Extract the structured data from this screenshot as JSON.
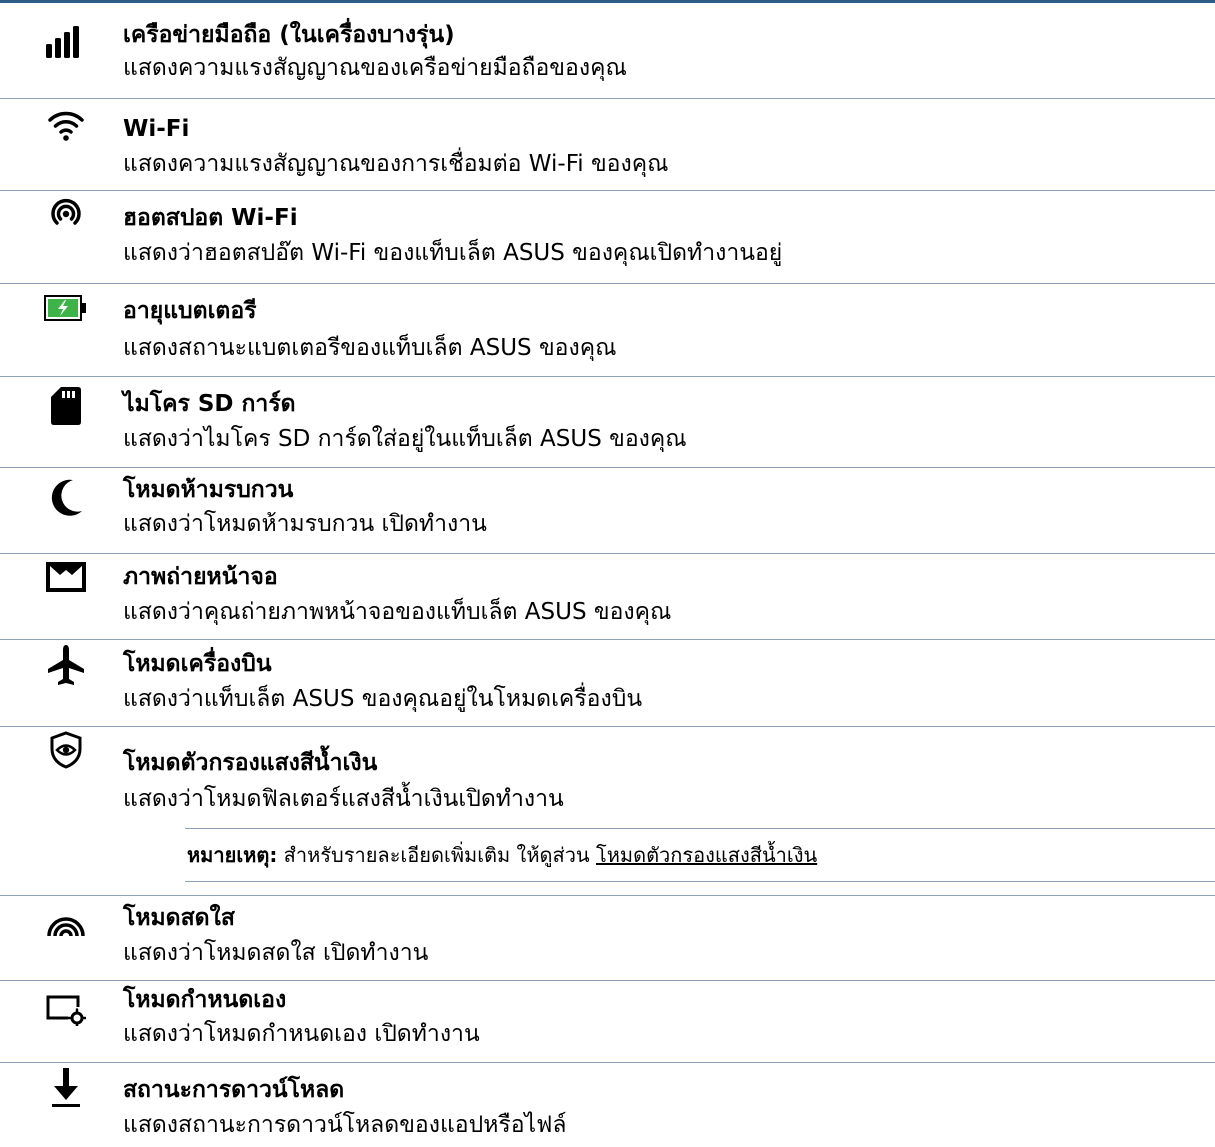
{
  "items": [
    {
      "icon": "signal-bars-icon",
      "title": "เครือข่ายมือถือ (ในเครื่องบางรุ่น)",
      "desc": "แสดงความแรงสัญญาณของเครือข่ายมือถือของคุณ"
    },
    {
      "icon": "wifi-icon",
      "title": "Wi-Fi",
      "desc": "แสดงความแรงสัญญาณของการเชื่อมต่อ Wi-Fi ของคุณ"
    },
    {
      "icon": "hotspot-icon",
      "title": "ฮอตสปอต Wi-Fi",
      "desc": "แสดงว่าฮอตสปอ๊ต Wi-Fi ของแท็บเล็ต ASUS ของคุณเปิดทำงานอยู่"
    },
    {
      "icon": "battery-charging-icon",
      "title": "อายุแบตเตอรี",
      "desc": "แสดงสถานะแบตเตอรีของแท็บเล็ต ASUS ของคุณ"
    },
    {
      "icon": "sd-card-icon",
      "title": "ไมโคร SD การ์ด",
      "desc": "แสดงว่าไมโคร SD การ์ดใส่อยู่ในแท็บเล็ต ASUS ของคุณ"
    },
    {
      "icon": "moon-icon",
      "title": "โหมดห้ามรบกวน",
      "desc": "แสดงว่าโหมดห้ามรบกวน เปิดทำงาน"
    },
    {
      "icon": "screenshot-icon",
      "title": "ภาพถ่ายหน้าจอ",
      "desc": "แสดงว่าคุณถ่ายภาพหน้าจอของแท็บเล็ต ASUS ของคุณ"
    },
    {
      "icon": "airplane-icon",
      "title": "โหมดเครื่องบิน",
      "desc": "แสดงว่าแท็บเล็ต ASUS ของคุณอยู่ในโหมดเครื่องบิน"
    },
    {
      "icon": "eye-shield-icon",
      "title": "โหมดตัวกรองแสงสีน้ำเงิน",
      "desc": "แสดงว่าโหมดฟิลเตอร์แสงสีน้ำเงินเปิดทำงาน"
    },
    {
      "icon": "vivid-mode-icon",
      "title": "โหมดสดใส",
      "desc": "แสดงว่าโหมดสดใส เปิดทำงาน"
    },
    {
      "icon": "custom-mode-icon",
      "title": "โหมดกำหนดเอง",
      "desc": "แสดงว่าโหมดกำหนดเอง เปิดทำงาน"
    },
    {
      "icon": "download-icon",
      "title": "สถานะการดาวน์โหลด",
      "desc": "แสดงสถานะการดาวน์โหลดของแอปหรือไฟล์"
    }
  ],
  "note": {
    "label": "หมายเหตุ:",
    "text": " สำหรับรายละเอียดเพิ่มเติม ให้ดูส่วน ",
    "link": "โหมดตัวกรองแสงสีน้ำเงิน"
  },
  "colors": {
    "rule": "#2f5d8a",
    "separator": "#8fa3b8",
    "battery": "#3db34a"
  }
}
